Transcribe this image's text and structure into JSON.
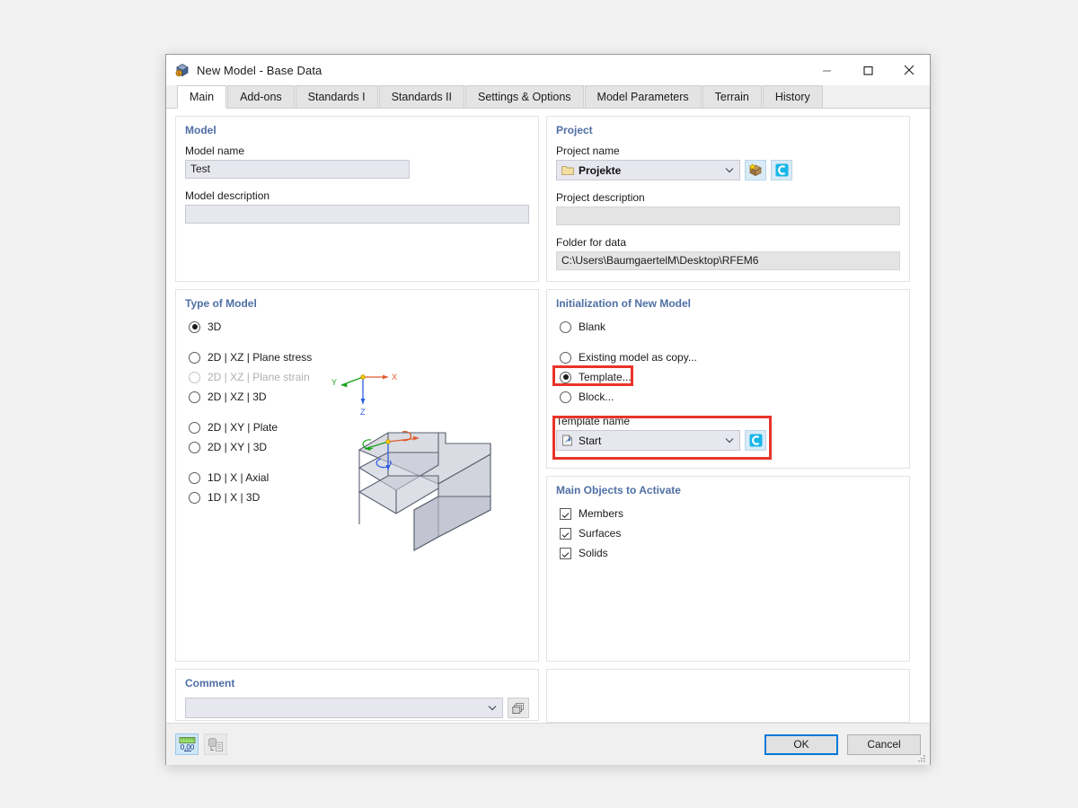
{
  "window": {
    "title": "New Model - Base Data",
    "app_icon": "rfem-cube-icon",
    "minimize_label": "Minimize",
    "maximize_label": "Maximize",
    "close_label": "Close"
  },
  "tabs": [
    {
      "label": "Main",
      "active": true
    },
    {
      "label": "Add-ons",
      "active": false
    },
    {
      "label": "Standards I",
      "active": false
    },
    {
      "label": "Standards II",
      "active": false
    },
    {
      "label": "Settings & Options",
      "active": false
    },
    {
      "label": "Model Parameters",
      "active": false
    },
    {
      "label": "Terrain",
      "active": false
    },
    {
      "label": "History",
      "active": false
    }
  ],
  "model": {
    "title": "Model",
    "name_label": "Model name",
    "name_value": "Test",
    "description_label": "Model description",
    "description_value": ""
  },
  "project": {
    "title": "Project",
    "name_label": "Project name",
    "name_value": "Projekte",
    "folder_icon": "folder-icon",
    "new_project_button": "new-project-icon",
    "info_button": "cyan-c-icon",
    "description_label": "Project description",
    "description_value": "",
    "folder_label": "Folder for data",
    "folder_value": "C:\\Users\\BaumgaertelM\\Desktop\\RFEM6"
  },
  "type_of_model": {
    "title": "Type of Model",
    "options": [
      {
        "label": "3D",
        "selected": true,
        "disabled": false
      },
      {
        "label": "2D | XZ | Plane stress",
        "selected": false,
        "disabled": false
      },
      {
        "label": "2D | XZ | Plane strain",
        "selected": false,
        "disabled": true
      },
      {
        "label": "2D | XZ | 3D",
        "selected": false,
        "disabled": false
      },
      {
        "label": "2D | XY | Plate",
        "selected": false,
        "disabled": false
      },
      {
        "label": "2D | XY | 3D",
        "selected": false,
        "disabled": false
      },
      {
        "label": "1D | X | Axial",
        "selected": false,
        "disabled": false
      },
      {
        "label": "1D | X | 3D",
        "selected": false,
        "disabled": false
      }
    ],
    "preview": {
      "axis_x": "X",
      "axis_y": "Y",
      "axis_z": "Z",
      "color_x": "#e05a2b",
      "color_y": "#17a317",
      "color_z": "#2b5ce0"
    }
  },
  "initialization": {
    "title": "Initialization of New Model",
    "options": [
      {
        "label": "Blank",
        "selected": false
      },
      {
        "label": "Existing model as copy...",
        "selected": false
      },
      {
        "label": "Template...",
        "selected": true,
        "highlighted": true
      },
      {
        "label": "Block...",
        "selected": false
      }
    ],
    "template_name_label": "Template name",
    "template_name_value": "Start",
    "template_icon": "template-document-icon",
    "template_info_button": "cyan-c-icon",
    "highlight_color": "#e8342a"
  },
  "main_objects": {
    "title": "Main Objects to Activate",
    "items": [
      {
        "label": "Members",
        "checked": true
      },
      {
        "label": "Surfaces",
        "checked": true
      },
      {
        "label": "Solids",
        "checked": true
      }
    ]
  },
  "comment": {
    "title": "Comment",
    "value": "",
    "picker_button": "comment-library-icon"
  },
  "footer": {
    "units_button": "0,00",
    "units_button_name": "units-and-decimal-places-icon",
    "import_button_name": "import-from-database-icon",
    "ok_label": "OK",
    "cancel_label": "Cancel"
  }
}
